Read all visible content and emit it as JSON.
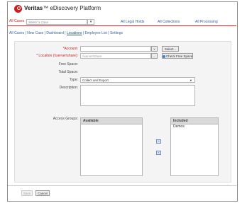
{
  "app": {
    "brand": "Veritas",
    "product": "™ eDiscovery Platform"
  },
  "topbar": {
    "active_tab": "All Cases",
    "case_placeholder": "Select a Case",
    "links": [
      "All Legal Holds",
      "All Collections",
      "All Processing"
    ]
  },
  "subnav": {
    "items": [
      "All Cases",
      "New Case",
      "Dashboard",
      "Locations",
      "Employee List",
      "Settings"
    ],
    "separator": "|",
    "current": "Locations"
  },
  "form": {
    "account_label": "*Account:",
    "account_clear": "×",
    "select_button": "Select...",
    "location_label": "* Location (\\\\server\\share):",
    "location_placeholder": "\\\\server\\share",
    "browse_button": "...",
    "check_free_space": "Check Free Space",
    "free_space_label": "Free Space:",
    "total_space_label": "Total Space:",
    "type_label": "Type:",
    "type_value": "Collect and Export",
    "description_label": "Description:",
    "access_groups_label": "Access Groups:",
    "available_header": "Available",
    "included_header": "Included",
    "included_items": [
      "Demos"
    ],
    "move_right": "»",
    "move_left": "«"
  },
  "footer": {
    "save_label": "Save",
    "cancel_label": "Cancel"
  },
  "colors": {
    "brand_red": "#cc1f1f",
    "link_blue": "#3a5fa0"
  }
}
